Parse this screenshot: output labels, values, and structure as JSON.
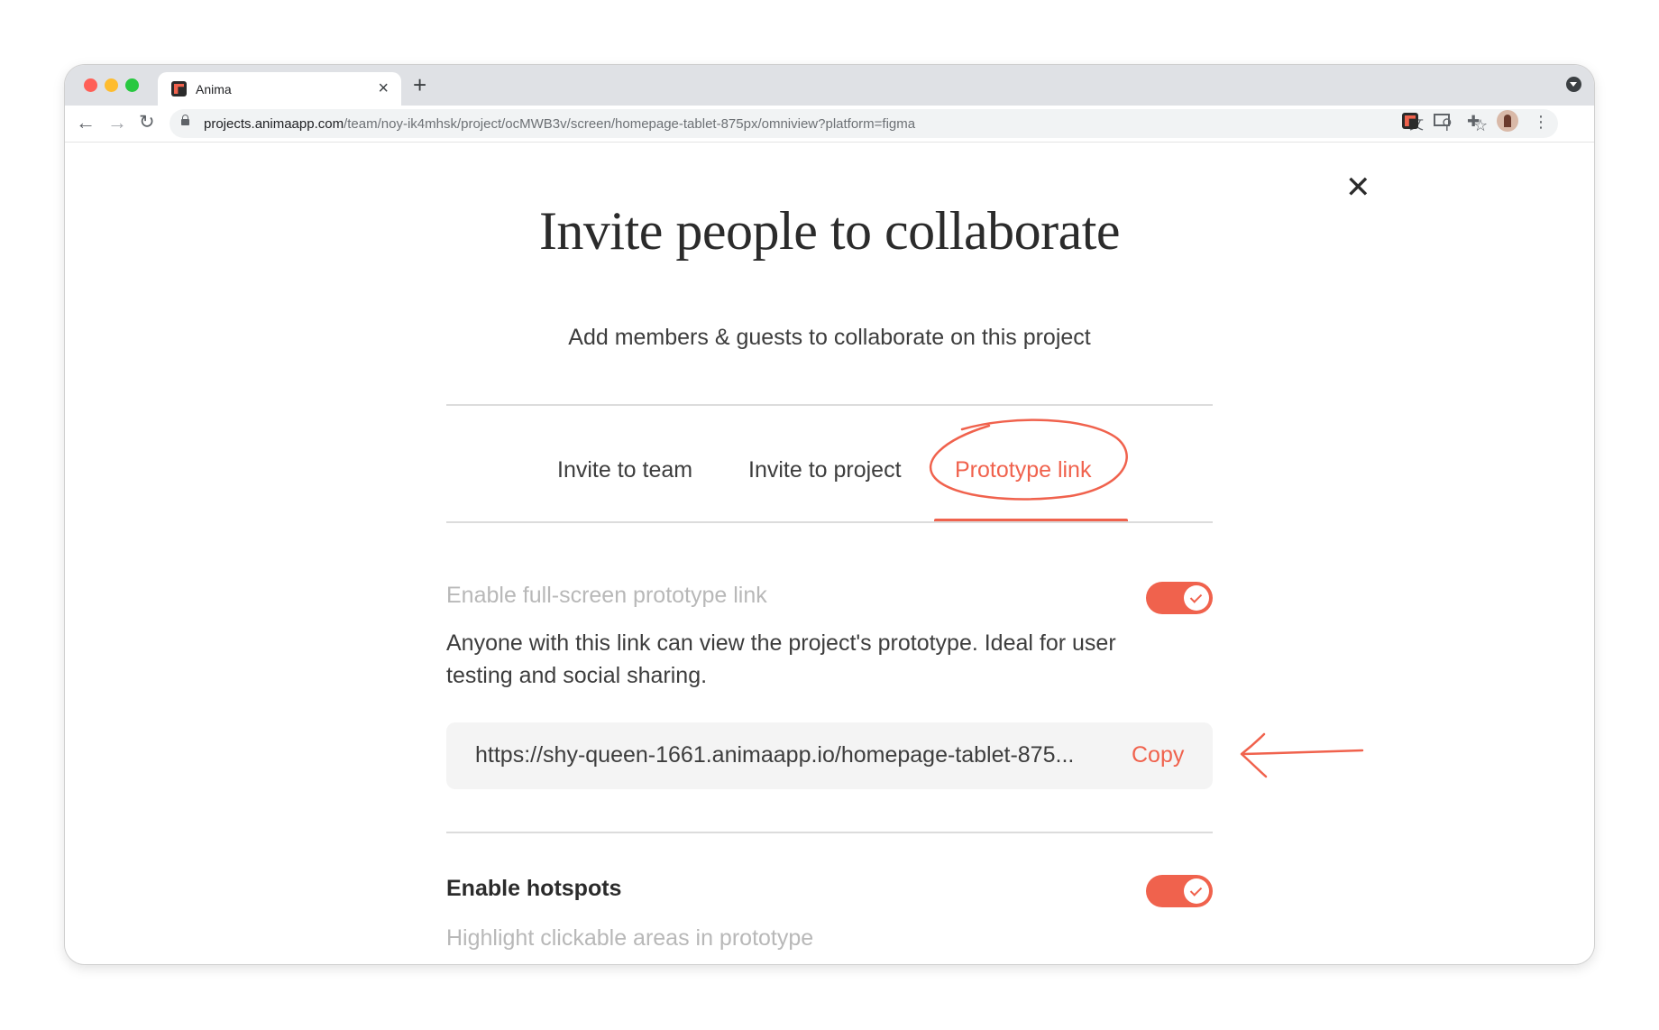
{
  "browser": {
    "tab_title": "Anima",
    "tab_close": "×",
    "new_tab": "+",
    "url_host": "projects.animaapp.com",
    "url_path": "/team/noy-ik4mhsk/project/ocMWB3v/screen/homepage-tablet-875px/omniview?platform=figma",
    "nav": {
      "back": "←",
      "forward": "→",
      "reload": "↻"
    },
    "toolbar_icons": {
      "translate": "文",
      "zoom": "⚲",
      "bookmark": "☆",
      "extensions": "✚",
      "menu": "⋮"
    }
  },
  "modal": {
    "close": "✕",
    "title": "Invite people to collaborate",
    "subtitle": "Add members & guests to collaborate on this project",
    "tabs": [
      {
        "label": "Invite to team",
        "active": false
      },
      {
        "label": "Invite to project",
        "active": false
      },
      {
        "label": "Prototype link",
        "active": true
      }
    ],
    "prototype": {
      "enable_label": "Enable full-screen prototype link",
      "enabled": true,
      "description": "Anyone with this link can view the project's prototype. Ideal for user testing and social sharing.",
      "link": "https://shy-queen-1661.animaapp.io/homepage-tablet-875...",
      "copy_label": "Copy"
    },
    "hotspots": {
      "label": "Enable hotspots",
      "enabled": true,
      "description": "Highlight clickable areas in prototype"
    }
  },
  "colors": {
    "accent": "#f0624d",
    "text_dark": "#2b2b2b",
    "text_muted": "#b8b8b8"
  }
}
